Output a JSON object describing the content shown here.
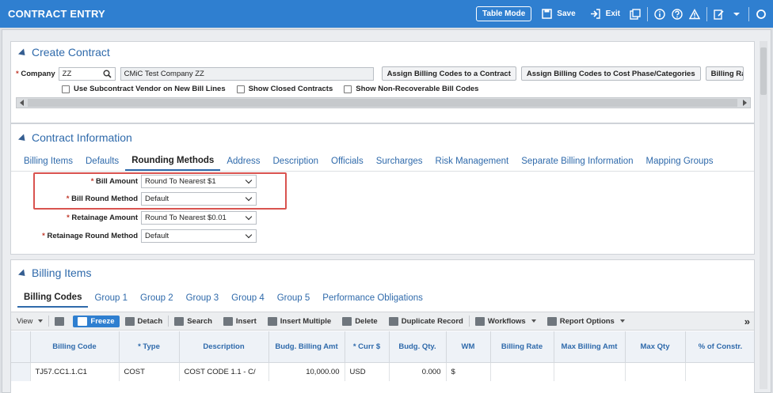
{
  "app": {
    "title": "CONTRACT ENTRY"
  },
  "topbar": {
    "table_mode": "Table Mode",
    "save": "Save",
    "exit": "Exit"
  },
  "create_contract": {
    "title": "Create Contract",
    "company_label": "Company",
    "company_value": "ZZ",
    "company_name": "CMiC Test Company ZZ",
    "buttons": [
      "Assign Billing Codes to a Contract",
      "Assign Billing Codes to Cost Phase/Categories",
      "Billing Ra"
    ],
    "checkboxes": [
      "Use Subcontract Vendor on New Bill Lines",
      "Show Closed Contracts",
      "Show Non-Recoverable Bill Codes"
    ]
  },
  "contract_info": {
    "title": "Contract Information",
    "tabs": [
      "Billing Items",
      "Defaults",
      "Rounding Methods",
      "Address",
      "Description",
      "Officials",
      "Surcharges",
      "Risk Management",
      "Separate Billing Information",
      "Mapping Groups"
    ],
    "active_tab": "Rounding Methods",
    "fields": [
      {
        "label": "Bill Amount",
        "value": "Round To Nearest $1"
      },
      {
        "label": "Bill Round Method",
        "value": "Default"
      },
      {
        "label": "Retainage Amount",
        "value": "Round To Nearest $0.01"
      },
      {
        "label": "Retainage Round Method",
        "value": "Default"
      }
    ]
  },
  "billing_items": {
    "title": "Billing Items",
    "tabs": [
      "Billing Codes",
      "Group 1",
      "Group 2",
      "Group 3",
      "Group 4",
      "Group 5",
      "Performance Obligations"
    ],
    "active_tab": "Billing Codes",
    "toolbar": {
      "view": "View",
      "freeze": "Freeze",
      "detach": "Detach",
      "search": "Search",
      "insert": "Insert",
      "insert_multiple": "Insert Multiple",
      "delete": "Delete",
      "duplicate": "Duplicate Record",
      "workflows": "Workflows",
      "report_options": "Report Options",
      "more": "»"
    },
    "columns": [
      "Billing Code",
      "* Type",
      "Description",
      "Budg. Billing Amt",
      "* Curr $",
      "Budg. Qty.",
      "WM",
      "Billing Rate",
      "Max Billing Amt",
      "Max Qty",
      "% of Constr."
    ],
    "rows": [
      [
        "TJ57.CC1.1.C1",
        "COST",
        "COST CODE 1.1 - C/",
        "10,000.00",
        "USD",
        "0.000",
        "$",
        "",
        "",
        "",
        ""
      ]
    ]
  },
  "colors": {
    "accent": "#2f7fd0",
    "highlight": "#d9534f"
  }
}
